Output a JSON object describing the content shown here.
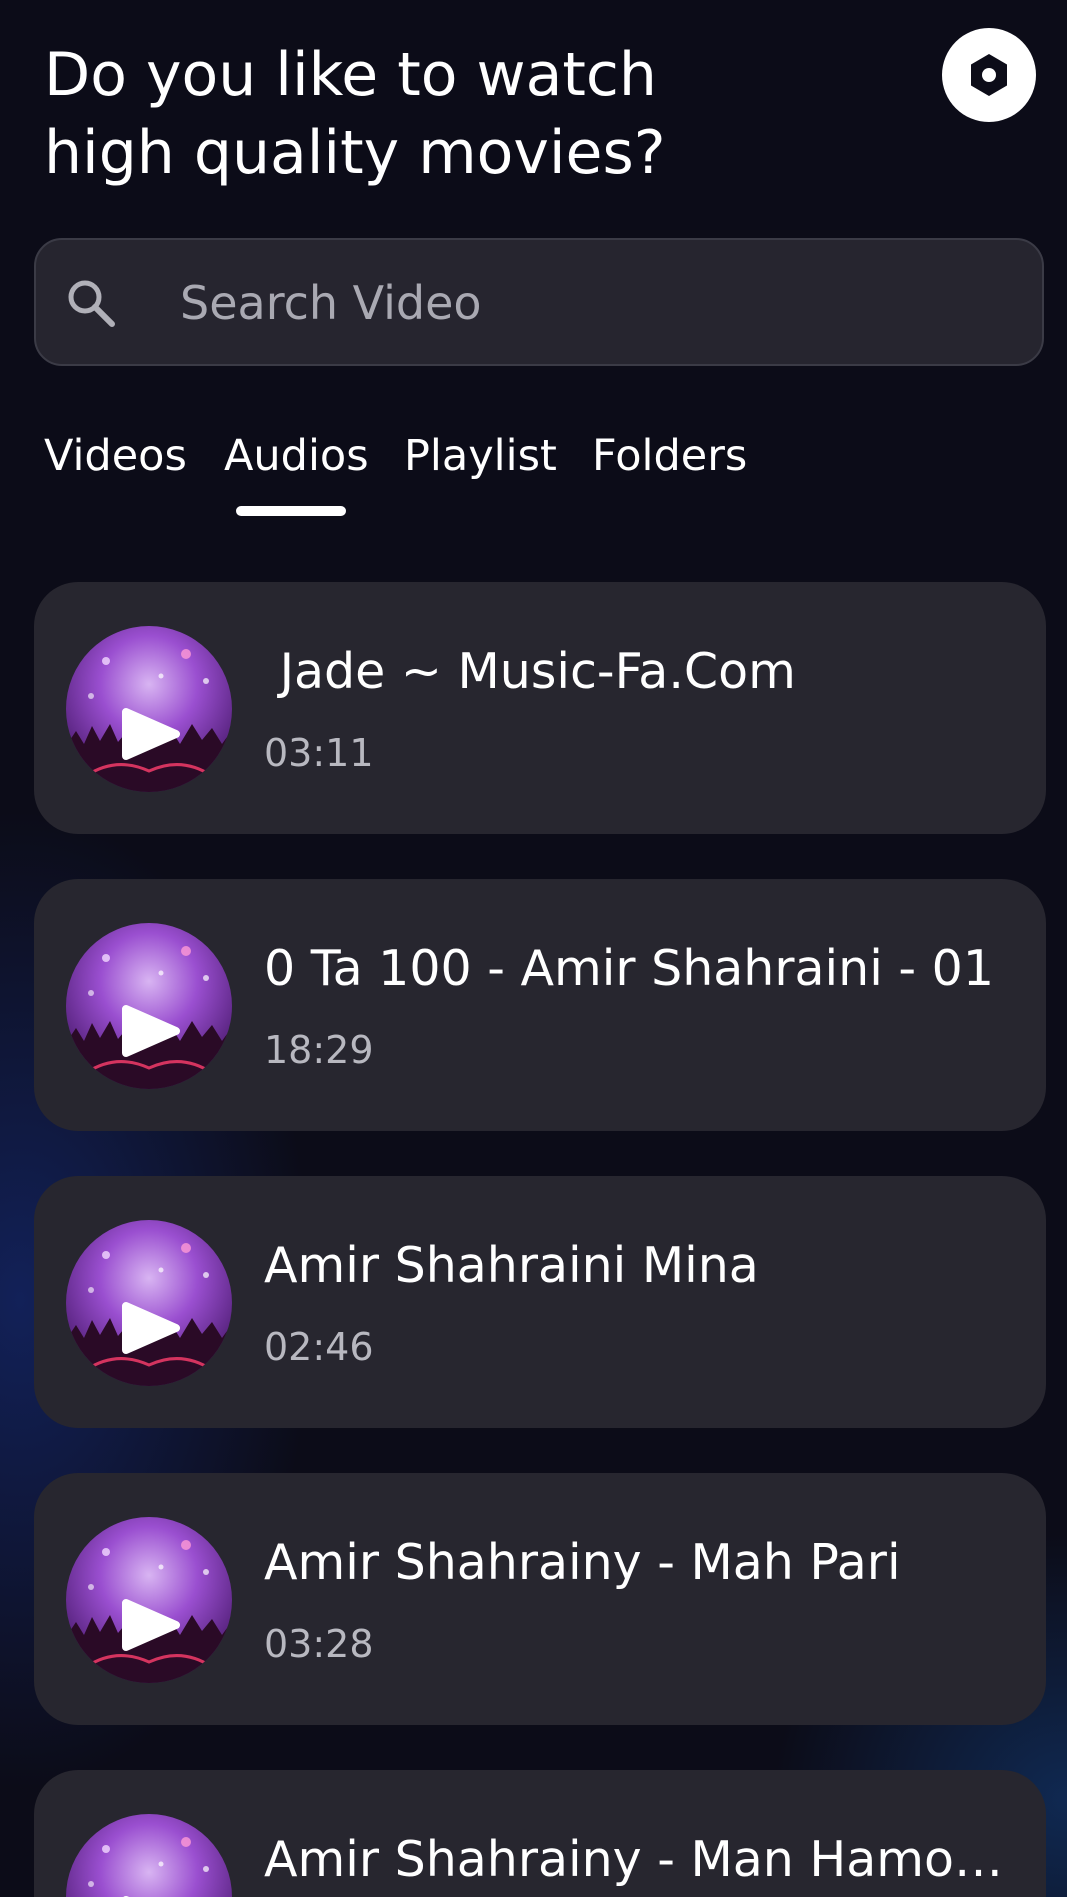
{
  "header": {
    "title_line1": "Do you like to watch",
    "title_line2": "high quality movies?",
    "settings_icon": "hexagon-settings-icon"
  },
  "search": {
    "placeholder": "Search Video",
    "value": "",
    "icon": "search-icon"
  },
  "tabs": [
    {
      "label": "Videos",
      "selected": false
    },
    {
      "label": "Audios",
      "selected": true
    },
    {
      "label": "Playlist",
      "selected": false
    },
    {
      "label": "Folders",
      "selected": false
    }
  ],
  "audios": [
    {
      "title": " Jade ~ Music-Fa.Com",
      "duration": "03:11"
    },
    {
      "title": "0 Ta 100 - Amir Shahraini - 01",
      "duration": "18:29"
    },
    {
      "title": "Amir Shahraini Mina",
      "duration": "02:46"
    },
    {
      "title": "Amir Shahrainy - Mah Pari",
      "duration": "03:28"
    },
    {
      "title": "Amir Shahrainy - Man Hamoon …",
      "duration": ""
    }
  ],
  "colors": {
    "background": "#0c0c18",
    "card": "#27262f",
    "search_bg": "#26252f",
    "muted_text": "#b8b8c0",
    "thumb_purple": "#8a3fc4"
  }
}
